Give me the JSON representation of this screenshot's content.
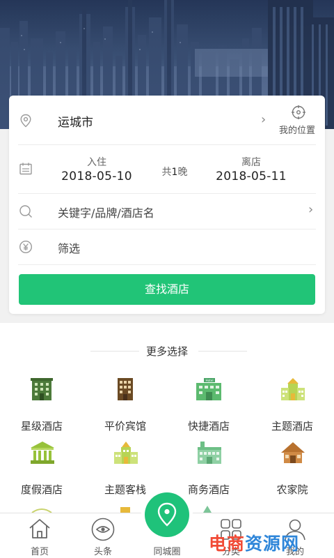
{
  "search": {
    "city": "运城市",
    "location_label": "我的位置",
    "checkin_label": "入住",
    "checkin_date": "2018-05-10",
    "checkout_label": "离店",
    "checkout_date": "2018-05-11",
    "nights_prefix": "共",
    "nights_count": "1",
    "nights_suffix": "晚",
    "keyword_placeholder": "关键字/品牌/酒店名",
    "filter_label": "筛选",
    "search_button": "查找酒店"
  },
  "more": {
    "title": "更多选择",
    "categories": [
      {
        "label": "星级酒店",
        "icon": "star-hotel-icon"
      },
      {
        "label": "平价宾馆",
        "icon": "budget-hotel-icon"
      },
      {
        "label": "快捷酒店",
        "icon": "express-hotel-icon"
      },
      {
        "label": "主题酒店",
        "icon": "theme-hotel-icon"
      },
      {
        "label": "度假酒店",
        "icon": "resort-hotel-icon"
      },
      {
        "label": "主题客栈",
        "icon": "theme-inn-icon"
      },
      {
        "label": "商务酒店",
        "icon": "business-hotel-icon"
      },
      {
        "label": "农家院",
        "icon": "farmhouse-icon"
      }
    ],
    "hotel_sign_text": "Hotel"
  },
  "nav": {
    "items": [
      {
        "label": "首页",
        "icon": "home-icon"
      },
      {
        "label": "头条",
        "icon": "eye-icon"
      },
      {
        "label": "同城圈",
        "icon": "location-pin-icon"
      },
      {
        "label": "分类",
        "icon": "grid-icon"
      },
      {
        "label": "我的",
        "icon": "user-icon"
      }
    ]
  },
  "watermark": {
    "part1": "电商",
    "part2": "资源网"
  },
  "colors": {
    "accent": "#21c477",
    "icon_dark_green": "#4c7a3a",
    "icon_light_green": "#a6cf49",
    "icon_brown": "#6b4a24",
    "icon_orange": "#b8712e"
  }
}
